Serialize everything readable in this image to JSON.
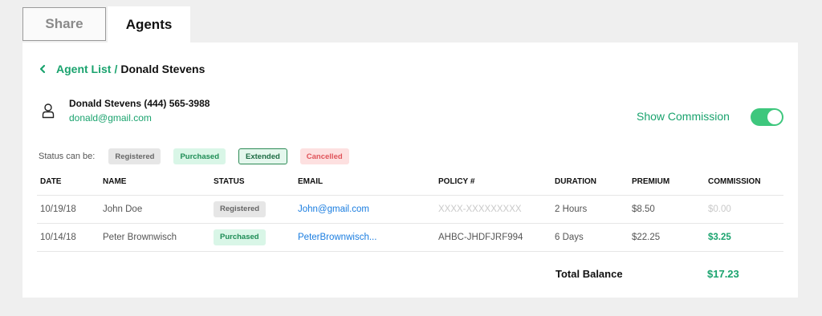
{
  "tabs": [
    {
      "label": "Share"
    },
    {
      "label": "Agents"
    }
  ],
  "breadcrumb": {
    "parent": "Agent List",
    "separator": "/",
    "current": "Donald Stevens"
  },
  "agent": {
    "name_phone": "Donald Stevens (444) 565-3988",
    "email": "donald@gmail.com"
  },
  "commission_toggle": {
    "label": "Show Commission",
    "on": true
  },
  "status_legend": {
    "title": "Status can be:",
    "statuses": [
      "Registered",
      "Purchased",
      "Extended",
      "Cancelled"
    ]
  },
  "table": {
    "headers": [
      "DATE",
      "NAME",
      "STATUS",
      "EMAIL",
      "POLICY #",
      "DURATION",
      "PREMIUM",
      "COMMISSION"
    ],
    "rows": [
      {
        "date": "10/19/18",
        "name": "John Doe",
        "status": "Registered",
        "email": "John@gmail.com",
        "policy": "XXXX-XXXXXXXXX",
        "duration": "2 Hours",
        "premium": "$8.50",
        "commission": "$0.00"
      },
      {
        "date": "10/14/18",
        "name": "Peter Brownwisch",
        "status": "Purchased",
        "email": "PeterBrownwisch...",
        "policy": "AHBC-JHDFJRF994",
        "duration": "6 Days",
        "premium": "$22.25",
        "commission": "$3.25"
      }
    ]
  },
  "total": {
    "label": "Total Balance",
    "value": "$17.23"
  },
  "colors": {
    "accent": "#1aa36e",
    "toggle": "#3ec77d",
    "link": "#1a7de0",
    "cancelled": "#e0545a"
  },
  "icons": {
    "back": "chevron-left-icon",
    "user": "user-icon"
  }
}
